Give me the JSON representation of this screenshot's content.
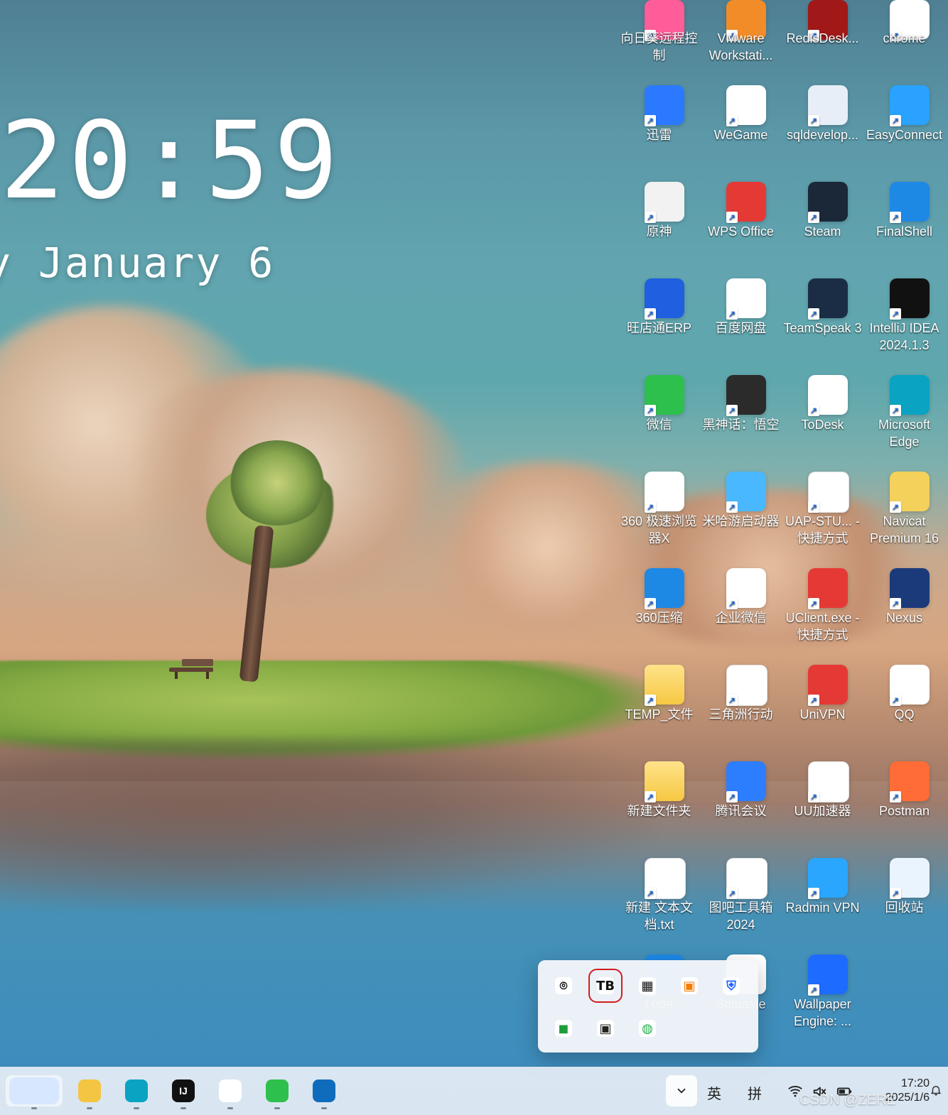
{
  "widget": {
    "time": "20:59",
    "date": "y January 6"
  },
  "desktop_icons": [
    {
      "label": "向日葵远程控制",
      "icon": "sunlogin-icon",
      "bg": "#ff5c9a"
    },
    {
      "label": "VMware Workstati...",
      "icon": "vmware-icon",
      "bg": "#f28c28"
    },
    {
      "label": "RedisDesk...",
      "icon": "redis-desktop-icon",
      "bg": "#a01818"
    },
    {
      "label": "chrome",
      "icon": "chrome-icon",
      "bg": "#ffffff"
    },
    {
      "label": "迅雷",
      "icon": "xunlei-icon",
      "bg": "#2b79ff"
    },
    {
      "label": "WeGame",
      "icon": "wegame-icon",
      "bg": "#ffffff"
    },
    {
      "label": "sqldevelop...",
      "icon": "sqldeveloper-icon",
      "bg": "#e7eef7"
    },
    {
      "label": "EasyConnect",
      "icon": "easyconnect-icon",
      "bg": "#2aa2ff"
    },
    {
      "label": "原神",
      "icon": "genshin-icon",
      "bg": "#f2f2f2"
    },
    {
      "label": "WPS Office",
      "icon": "wps-icon",
      "bg": "#e53935"
    },
    {
      "label": "Steam",
      "icon": "steam-icon",
      "bg": "#1b2838"
    },
    {
      "label": "FinalShell",
      "icon": "finalshell-icon",
      "bg": "#1e88e5"
    },
    {
      "label": "旺店通ERP",
      "icon": "wangdiantong-icon",
      "bg": "#1f5fe0"
    },
    {
      "label": "百度网盘",
      "icon": "baidu-netdisk-icon",
      "bg": "#ffffff"
    },
    {
      "label": "TeamSpeak 3",
      "icon": "teamspeak-icon",
      "bg": "#1b2d45"
    },
    {
      "label": "IntelliJ IDEA 2024.1.3",
      "icon": "intellij-idea-icon",
      "bg": "#111111"
    },
    {
      "label": "微信",
      "icon": "wechat-icon",
      "bg": "#2ec04d"
    },
    {
      "label": "黑神话：悟空",
      "icon": "black-myth-icon",
      "bg": "#2b2b2b"
    },
    {
      "label": "ToDesk",
      "icon": "todesk-icon",
      "bg": "#ffffff"
    },
    {
      "label": "Microsoft Edge",
      "icon": "edge-icon",
      "bg": "#0aa3c2"
    },
    {
      "label": "360 极速浏览器X",
      "icon": "360-browser-icon",
      "bg": "#ffffff"
    },
    {
      "label": "米哈游启动器",
      "icon": "mihoyo-launcher-icon",
      "bg": "#4ab8ff"
    },
    {
      "label": "UAP-STU... - 快捷方式",
      "icon": "file-shortcut-icon",
      "bg": "#ffffff"
    },
    {
      "label": "Navicat Premium 16",
      "icon": "navicat-icon",
      "bg": "#f4d15a"
    },
    {
      "label": "360压缩",
      "icon": "360zip-icon",
      "bg": "#1e88e5"
    },
    {
      "label": "企业微信",
      "icon": "wecom-icon",
      "bg": "#ffffff"
    },
    {
      "label": "UClient.exe - 快捷方式",
      "icon": "uclient-icon",
      "bg": "#e53935"
    },
    {
      "label": "Nexus",
      "icon": "nexus-icon",
      "bg": "#1b3a7a"
    },
    {
      "label": "TEMP_文件",
      "icon": "folder-icon",
      "bg": "#f8d25a"
    },
    {
      "label": "三角洲行动",
      "icon": "file-shortcut-icon",
      "bg": "#ffffff"
    },
    {
      "label": "UniVPN",
      "icon": "univpn-icon",
      "bg": "#e53935"
    },
    {
      "label": "QQ",
      "icon": "qq-icon",
      "bg": "#ffffff"
    },
    {
      "label": "新建文件夹",
      "icon": "folder-icon",
      "bg": "#f8d25a"
    },
    {
      "label": "腾讯会议",
      "icon": "tencent-meeting-icon",
      "bg": "#2d7dff"
    },
    {
      "label": "UU加速器",
      "icon": "file-shortcut-icon",
      "bg": "#ffffff"
    },
    {
      "label": "Postman",
      "icon": "postman-icon",
      "bg": "#ff6c37"
    },
    {
      "label": "新建 文本文档.txt",
      "icon": "text-file-icon",
      "bg": "#ffffff"
    },
    {
      "label": "图吧工具箱 2024",
      "icon": "file-shortcut-icon",
      "bg": "#ffffff"
    },
    {
      "label": "Radmin VPN",
      "icon": "radmin-vpn-icon",
      "bg": "#2aa6ff"
    },
    {
      "label": "回收站",
      "icon": "recycle-bin-icon",
      "bg": "#e9f4ff"
    },
    {
      "label": "l ode",
      "icon": "hidden-icon",
      "bg": "#1e88e5"
    },
    {
      "label": "Snipaste",
      "icon": "snipaste-icon",
      "bg": "#ffffff"
    },
    {
      "label": "Wallpaper Engine: ...",
      "icon": "wallpaper-engine-icon",
      "bg": "#1e6bff"
    }
  ],
  "tray_popup": {
    "items": [
      {
        "icon": "camera-lens-icon",
        "text": "⌾",
        "bg": "#ffffff",
        "fg": "#111111",
        "selected": false
      },
      {
        "icon": "tb-icon",
        "text": "TB",
        "bg": "#ffffff",
        "fg": "#111111",
        "selected": true
      },
      {
        "icon": "black-app-icon",
        "text": "▦",
        "bg": "#ffffff",
        "fg": "#111111",
        "selected": false
      },
      {
        "icon": "orange-app-icon",
        "text": "▣",
        "bg": "#ffffff",
        "fg": "#f57c00",
        "selected": false
      },
      {
        "icon": "shield-icon",
        "text": "⛨",
        "bg": "#ffffff",
        "fg": "#1e63ff",
        "selected": false
      },
      {
        "icon": "nvidia-icon",
        "text": "◼",
        "bg": "#ffffff",
        "fg": "#1e9e3a",
        "selected": false
      },
      {
        "icon": "dark-square-icon",
        "text": "▣",
        "bg": "#ffffff",
        "fg": "#222222",
        "selected": false
      },
      {
        "icon": "wechat-tray-icon",
        "text": "◍",
        "bg": "#ffffff",
        "fg": "#22b04b",
        "selected": false
      }
    ]
  },
  "taskbar": {
    "apps": [
      {
        "icon": "castle-widget-icon",
        "label": "",
        "bg": "#d7e7ff"
      },
      {
        "icon": "file-explorer-icon",
        "label": "",
        "bg": "#f4c542"
      },
      {
        "icon": "edge-icon",
        "label": "",
        "bg": "#0aa3c2"
      },
      {
        "icon": "intellij-idea-icon",
        "label": "IJ",
        "bg": "#111111"
      },
      {
        "icon": "photos-icon",
        "label": "",
        "bg": "#ffffff"
      },
      {
        "icon": "wechat-icon",
        "label": "",
        "bg": "#2ec04d"
      },
      {
        "icon": "microsoft-store-icon",
        "label": "",
        "bg": "#0f6cbd"
      }
    ],
    "tray": {
      "ime_lang": "英",
      "ime_mode": "拼",
      "time": "17:20",
      "date": "2025/1/6"
    },
    "watermark": "CSDN @ZERE"
  }
}
